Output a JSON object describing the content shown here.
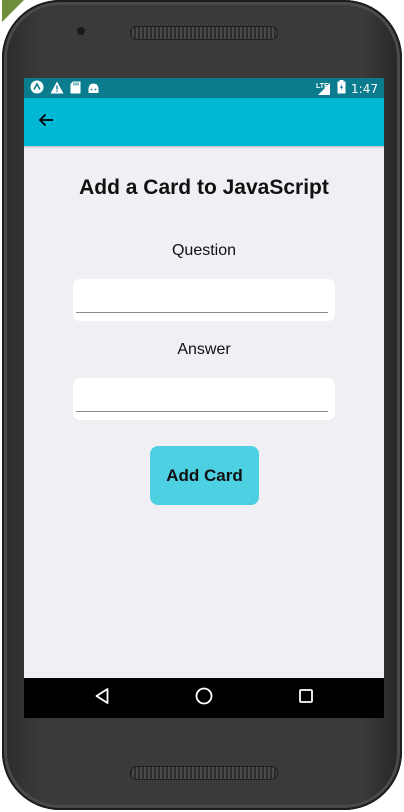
{
  "status_bar": {
    "time": "1:47",
    "network_label": "LTE",
    "left_icons": [
      "app-icon",
      "warning-icon",
      "sd-card-icon",
      "android-icon"
    ],
    "right_icons": [
      "signal-icon",
      "battery-icon"
    ]
  },
  "toolbar": {
    "back_icon": "arrow-left-icon",
    "color": "#00b8d4"
  },
  "main": {
    "title": "Add a Card to JavaScript",
    "question_label": "Question",
    "question_value": "",
    "answer_label": "Answer",
    "answer_value": "",
    "add_button_label": "Add Card",
    "button_color": "#4dd0e1",
    "background": "#efeff4"
  },
  "nav_bar": {
    "items": [
      "back-triangle-icon",
      "home-circle-icon",
      "recents-square-icon"
    ]
  }
}
